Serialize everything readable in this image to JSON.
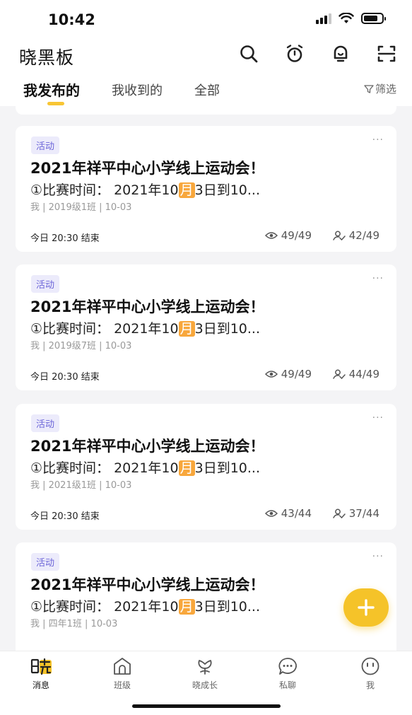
{
  "status_bar": {
    "time": "10:42"
  },
  "header": {
    "app_title": "晓黑板"
  },
  "tabs": [
    {
      "label": "我发布的"
    },
    {
      "label": "我收到的"
    },
    {
      "label": "全部"
    }
  ],
  "filter_label": "筛选",
  "cards": [
    {
      "tag": "活动",
      "more": "···",
      "title": "2021年祥平中心小学线上运动会！",
      "desc_before": "①比赛时间：  2021年10",
      "desc_highlight": "月",
      "desc_after": "3日到10...",
      "meta": "我 | 2019级1班  | 10-03",
      "deadline": "今日 20:30 结束",
      "views": "49/49",
      "done": "42/49"
    },
    {
      "tag": "活动",
      "more": "···",
      "title": "2021年祥平中心小学线上运动会！",
      "desc_before": "①比赛时间：  2021年10",
      "desc_highlight": "月",
      "desc_after": "3日到10...",
      "meta": "我 | 2019级7班  | 10-03",
      "deadline": "今日 20:30 结束",
      "views": "49/49",
      "done": "44/49"
    },
    {
      "tag": "活动",
      "more": "···",
      "title": "2021年祥平中心小学线上运动会！",
      "desc_before": "①比赛时间：  2021年10",
      "desc_highlight": "月",
      "desc_after": "3日到10...",
      "meta": "我 | 2021级1班  | 10-03",
      "deadline": "今日 20:30 结束",
      "views": "43/44",
      "done": "37/44"
    },
    {
      "tag": "活动",
      "more": "···",
      "title": "2021年祥平中心小学线上运动会！",
      "desc_before": "①比赛时间：  2021年10",
      "desc_highlight": "月",
      "desc_after": "3日到10...",
      "meta": "我 | 四年1班  | 10-03"
    }
  ],
  "bottom_nav": [
    {
      "label": "消息",
      "icon": "xiao-logo-icon"
    },
    {
      "label": "班级",
      "icon": "home-icon"
    },
    {
      "label": "晓成长",
      "icon": "flower-icon"
    },
    {
      "label": "私聊",
      "icon": "chat-bubble-icon"
    },
    {
      "label": "我",
      "icon": "smiley-icon"
    }
  ],
  "colors": {
    "accent": "#f5c329",
    "tag_bg": "#ecebfb",
    "tag_text": "#6d66d9",
    "highlight": "#f8a73c"
  }
}
